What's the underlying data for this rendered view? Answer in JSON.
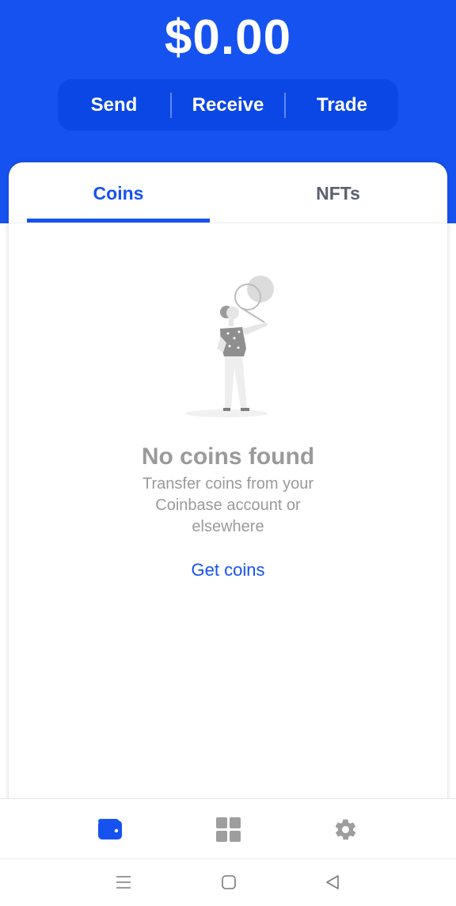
{
  "wallet": {
    "balance": "$0.00"
  },
  "actions": {
    "send_label": "Send",
    "receive_label": "Receive",
    "trade_label": "Trade"
  },
  "tabs": [
    {
      "label": "Coins",
      "active": true
    },
    {
      "label": "NFTs",
      "active": false
    }
  ],
  "empty_state": {
    "title": "No coins found",
    "description_lines": [
      "Transfer coins from your",
      "Coinbase account or",
      "elsewhere"
    ],
    "link_label": "Get coins"
  },
  "bottom_nav": {
    "items": [
      {
        "icon": "wallet-icon",
        "active": true
      },
      {
        "icon": "apps-grid-icon",
        "active": false
      },
      {
        "icon": "gear-icon",
        "active": false
      }
    ]
  },
  "system_nav": {
    "items": [
      {
        "icon": "menu-icon"
      },
      {
        "icon": "home-square-icon"
      },
      {
        "icon": "back-triangle-icon"
      }
    ]
  },
  "colors": {
    "brand_blue": "#1652f0",
    "action_bar_blue": "#0b47e4",
    "muted_text": "#9a9a9a",
    "inactive_icon": "#9e9e9e"
  }
}
